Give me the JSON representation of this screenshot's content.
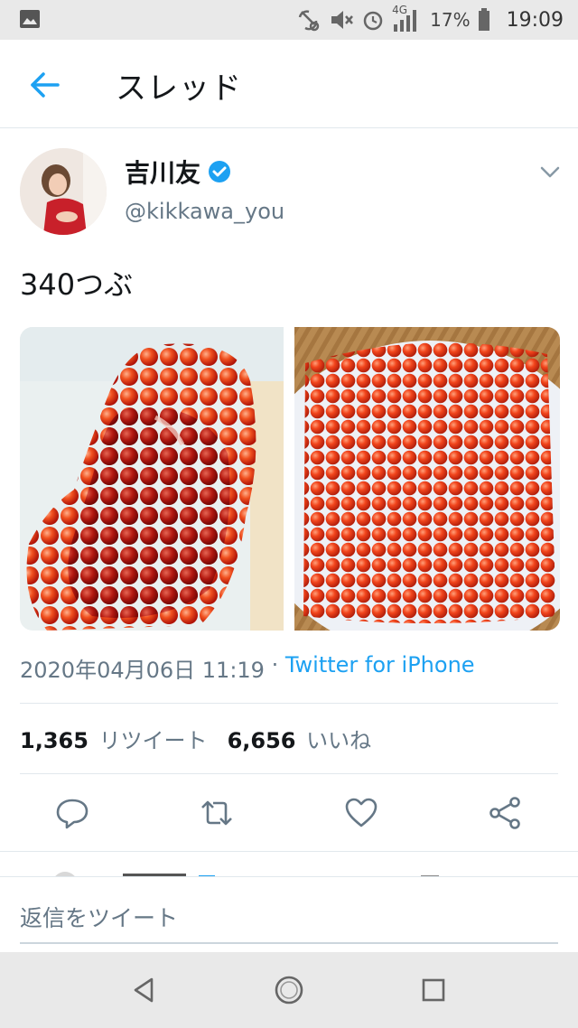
{
  "status_bar": {
    "network": "4G",
    "battery": "17%",
    "time": "19:09",
    "icons": [
      "image-icon",
      "nfc-icon",
      "mute-icon",
      "alarm-icon",
      "signal-icon",
      "battery-icon"
    ]
  },
  "header": {
    "title": "スレッド",
    "back_icon": "arrow-left-icon"
  },
  "tweet": {
    "author_name": "吉川友",
    "verified": true,
    "handle": "@kikkawa_you",
    "text": "340つぶ",
    "media": [
      "salmon-roe-photo-1",
      "salmon-roe-photo-2"
    ],
    "date": "2020年04月06日 11:19",
    "separator": " · ",
    "source": "Twitter for iPhone",
    "retweets_count": "1,365",
    "retweets_label": "リツイート",
    "likes_count": "6,656",
    "likes_label": "いいね"
  },
  "actions": [
    "reply-icon",
    "retweet-icon",
    "like-icon",
    "share-icon"
  ],
  "reply_bar": {
    "placeholder": "返信をツイート"
  },
  "nav": [
    "back-triangle-icon",
    "home-circle-icon",
    "recents-square-icon"
  ],
  "colors": {
    "accent": "#1da1f2",
    "secondary_text": "#657786",
    "roe": "#e8401e"
  }
}
